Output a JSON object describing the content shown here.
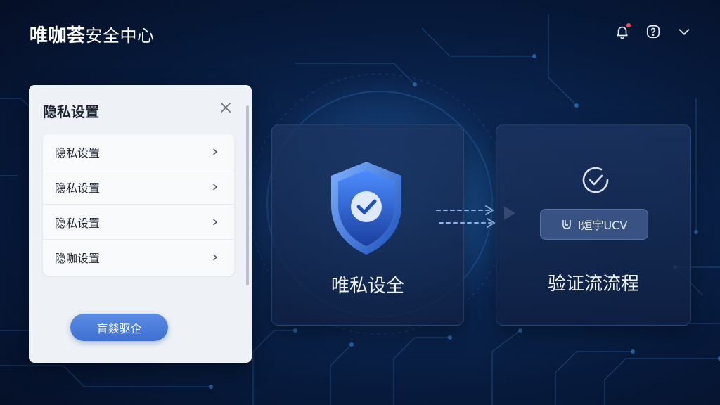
{
  "header": {
    "title_bold": "唯咖荟",
    "title_rest": "安全中心",
    "icons": [
      "bell-icon",
      "help-icon",
      "chevron-down-icon"
    ],
    "notification_dot_color": "#ff4d4f"
  },
  "privacy_panel": {
    "title": "隐私设置",
    "items": [
      {
        "label": "隐私设置"
      },
      {
        "label": "隐私设置"
      },
      {
        "label": "隐私设置"
      },
      {
        "label": "隐咖设置"
      }
    ],
    "button_label": "盲燚驱企"
  },
  "privacy_card": {
    "label": "唯私设全"
  },
  "verify_card": {
    "pill_label": "I烜宇UCV",
    "label": "验证流流程"
  },
  "colors": {
    "accent": "#3f6fd0",
    "background": "#071a3c",
    "shield": "#2a63d6"
  }
}
